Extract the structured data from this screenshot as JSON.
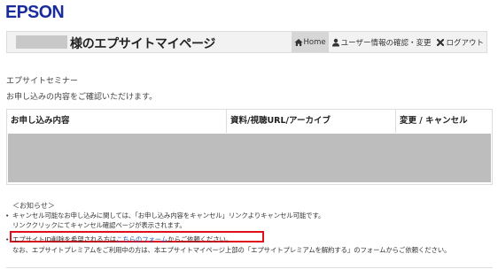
{
  "brand": {
    "logo_text": "EPSON",
    "color": "#1a2b9c"
  },
  "header": {
    "title": "様のエプサイトマイページ",
    "nav": [
      {
        "label": "Home",
        "icon": "home-icon",
        "active": true
      },
      {
        "label": "ユーザー情報の確認・変更",
        "icon": "user-icon",
        "active": false
      },
      {
        "label": "ログアウト",
        "icon": "close-icon",
        "active": false
      }
    ]
  },
  "main": {
    "subtitle": "エプサイトセミナー",
    "intro": "お申し込みの内容をご確認いただけます。",
    "table": {
      "columns": [
        "お申し込み内容",
        "資料/視聴URL/アーカイブ",
        "変更 / キャンセル"
      ]
    }
  },
  "notices": {
    "heading": "＜お知らせ＞",
    "line1_bullet": "•",
    "line1": "キャンセル可能なお申し込みに関しては、「お申し込み内容をキャンセル」リンクよりキャンセル可能です。",
    "line2": "リンククリックにてキャンセル確認ページが表示されます。",
    "line3_bullet": "•",
    "line3_prefix": "エプサイトID削除を希望される方は",
    "line3_link": "こちらのフォーム",
    "line3_suffix": "からご依頼ください。",
    "line4": "なお、エプサイトプレミアムをご利用中の方は、本エプサイトマイページ上部の「エプサイトプレミアムを解約する」のフォームからご依頼ください。",
    "highlight_color": "#e0101a",
    "link_color": "#1a5ec2"
  }
}
